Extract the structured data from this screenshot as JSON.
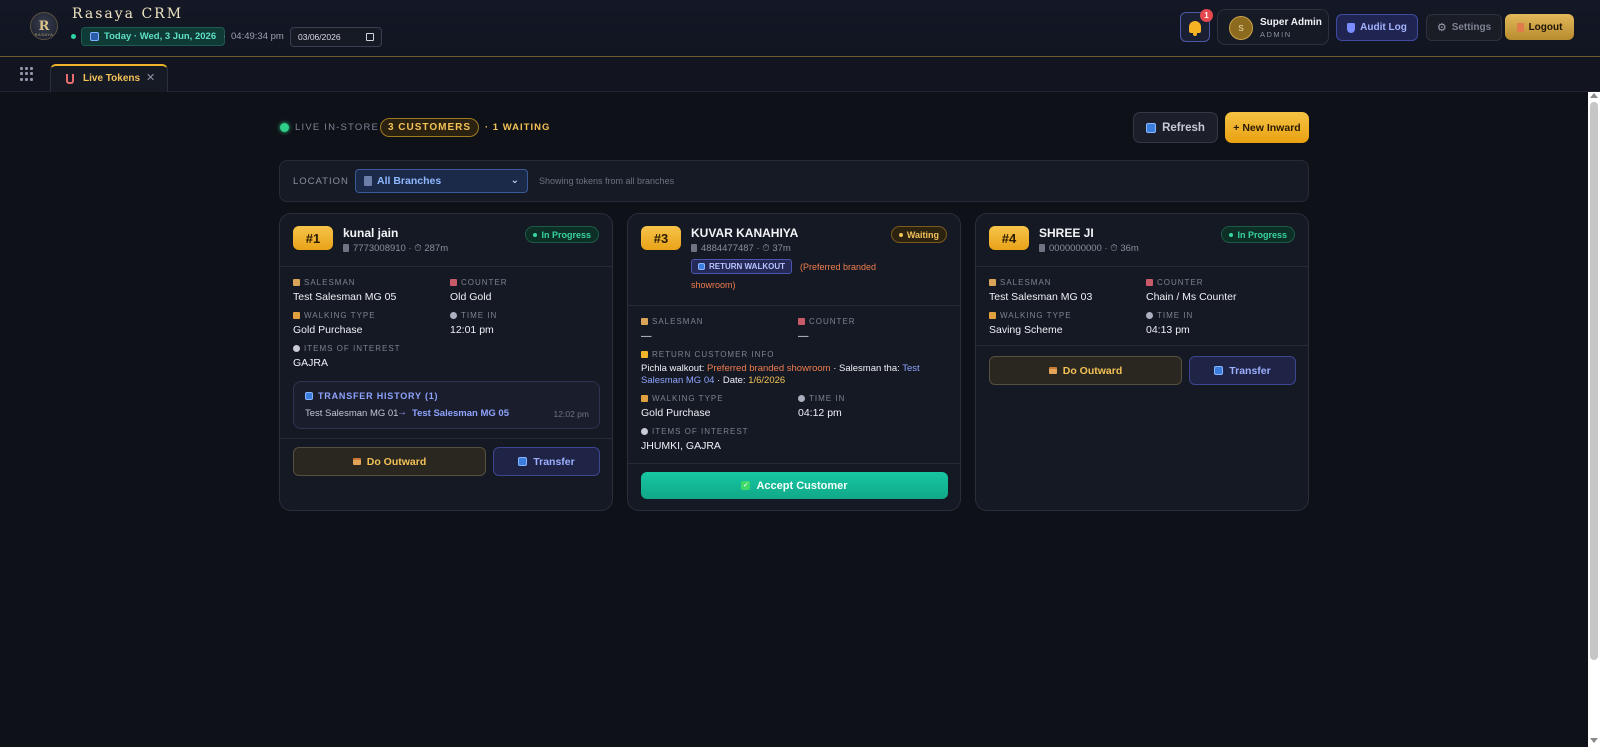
{
  "app": {
    "title": "Rasaya CRM",
    "logo_text": "R",
    "logo_sub": "RASAYA",
    "today_label": "Today · Wed, 3 Jun, 2026",
    "clock": "04:49:34 pm",
    "date_value": "03/06/2026"
  },
  "header": {
    "notifications_count": "1",
    "user_initial": "S",
    "user_name": "Super Admin",
    "user_role": "ADMIN",
    "audit_label": "Audit Log",
    "settings_label": "Settings",
    "logout_label": "Logout"
  },
  "tabs": [
    {
      "label": "Live Tokens",
      "active": true
    }
  ],
  "status": {
    "label": "LIVE IN-STORE",
    "customers": "3 CUSTOMERS",
    "waiting": "· 1 WAITING",
    "refresh_label": "Refresh",
    "new_inward_label": "+ New Inward"
  },
  "location": {
    "label": "LOCATION",
    "selected": "All Branches",
    "hint": "Showing tokens from all branches"
  },
  "cards": [
    {
      "token": "#1",
      "name": "kunal jain",
      "phone": "7773008910",
      "elapsed": "287m",
      "status": "In Progress",
      "salesman_label": "SALESMAN",
      "salesman": "Test Salesman MG 05",
      "counter_label": "COUNTER",
      "counter": "Old Gold",
      "walking_label": "WALKING TYPE",
      "walking": "Gold Purchase",
      "time_label": "TIME IN",
      "time_in": "12:01 pm",
      "items_label": "ITEMS OF INTEREST",
      "items": "GAJRA",
      "transfer_title": "TRANSFER HISTORY (1)",
      "transfer_from": "Test Salesman MG 01",
      "transfer_arrow": "→",
      "transfer_to": "Test Salesman MG 05",
      "transfer_time": "12:02 pm",
      "outward_label": "Do Outward",
      "transfer_label": "Transfer"
    },
    {
      "token": "#3",
      "name": "KUVAR KANAHIYA",
      "phone": "4884477487",
      "elapsed": "37m",
      "status": "Waiting",
      "return_badge": "RETURN WALKOUT",
      "return_note_1": "(Preferred branded",
      "return_note_2": "showroom)",
      "salesman_label": "SALESMAN",
      "salesman": "—",
      "counter_label": "COUNTER",
      "counter": "—",
      "return_info_label": "RETURN CUSTOMER INFO",
      "return_info": {
        "walkout_label": "Pichla walkout: ",
        "walkout_value": "Preferred branded showroom",
        "salesman_label": " · Salesman tha: ",
        "salesman_value": "Test Salesman MG 04",
        "date_label": " · Date: ",
        "date_value": "1/6/2026"
      },
      "walking_label": "WALKING TYPE",
      "walking": "Gold Purchase",
      "time_label": "TIME IN",
      "time_in": "04:12 pm",
      "items_label": "ITEMS OF INTEREST",
      "items": "JHUMKI, GAJRA",
      "accept_label": "Accept Customer"
    },
    {
      "token": "#4",
      "name": "SHREE JI",
      "phone": "0000000000",
      "elapsed": "36m",
      "status": "In Progress",
      "salesman_label": "SALESMAN",
      "salesman": "Test Salesman MG 03",
      "counter_label": "COUNTER",
      "counter": "Chain / Ms Counter",
      "walking_label": "WALKING TYPE",
      "walking": "Saving Scheme",
      "time_label": "TIME IN",
      "time_in": "04:13 pm",
      "outward_label": "Do Outward",
      "transfer_label": "Transfer"
    }
  ],
  "colors": {
    "accent_gold": "#f3c257",
    "progress_green": "#38d3a0",
    "teal_accept": "#18c7a2",
    "link_blue": "#8fa3ff"
  }
}
